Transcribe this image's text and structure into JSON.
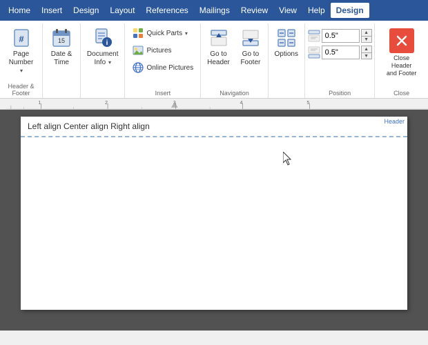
{
  "menuBar": {
    "tabs": [
      {
        "id": "home",
        "label": "Home",
        "active": false
      },
      {
        "id": "insert",
        "label": "Insert",
        "active": false
      },
      {
        "id": "design",
        "label": "Design",
        "active": false
      },
      {
        "id": "layout",
        "label": "Layout",
        "active": false
      },
      {
        "id": "references",
        "label": "References",
        "active": false
      },
      {
        "id": "mailings",
        "label": "Mailings",
        "active": false
      },
      {
        "id": "review",
        "label": "Review",
        "active": false
      },
      {
        "id": "view",
        "label": "View",
        "active": false
      },
      {
        "id": "help",
        "label": "Help",
        "active": false
      },
      {
        "id": "design-active",
        "label": "Design",
        "active": true
      }
    ]
  },
  "ribbon": {
    "groups": [
      {
        "id": "header-footer",
        "label": "Header & Footer",
        "buttons": [
          {
            "id": "page-number",
            "label": "Page\nNumber",
            "icon": "#"
          }
        ]
      },
      {
        "id": "date-time",
        "label": "",
        "bigLabel": "Date &\nTime",
        "icon": "🗓"
      },
      {
        "id": "document-info",
        "label": "Document\nInfo",
        "icon": "📄",
        "hasDropdown": true
      },
      {
        "id": "insert",
        "label": "Insert",
        "smallButtons": [
          {
            "id": "quick-parts",
            "label": "Quick Parts",
            "icon": "Ω",
            "hasDropdown": true
          },
          {
            "id": "pictures",
            "label": "Pictures",
            "icon": "🖼"
          },
          {
            "id": "online-pictures",
            "label": "Online Pictures",
            "icon": "🌐"
          }
        ]
      },
      {
        "id": "navigation",
        "label": "Navigation",
        "buttons": [
          {
            "id": "go-to-header",
            "label": "Go to\nHeader",
            "icon": "⬆"
          },
          {
            "id": "go-to-footer",
            "label": "Go to\nFooter",
            "icon": "⬇"
          }
        ]
      },
      {
        "id": "options",
        "label": "",
        "bigLabel": "Options",
        "icon": "☑"
      },
      {
        "id": "position",
        "label": "Position",
        "inputs": [
          {
            "id": "header-pos",
            "value": "0.5\""
          },
          {
            "id": "footer-pos",
            "value": "0.5\""
          }
        ]
      },
      {
        "id": "close",
        "label": "Close",
        "bigLabel": "Close Header\nand Footer",
        "icon": "✕"
      }
    ]
  },
  "ruler": {
    "markers": [
      "1",
      "2",
      "3",
      "4",
      "5"
    ]
  },
  "document": {
    "headerText": "Left align    Center align    Right align"
  }
}
